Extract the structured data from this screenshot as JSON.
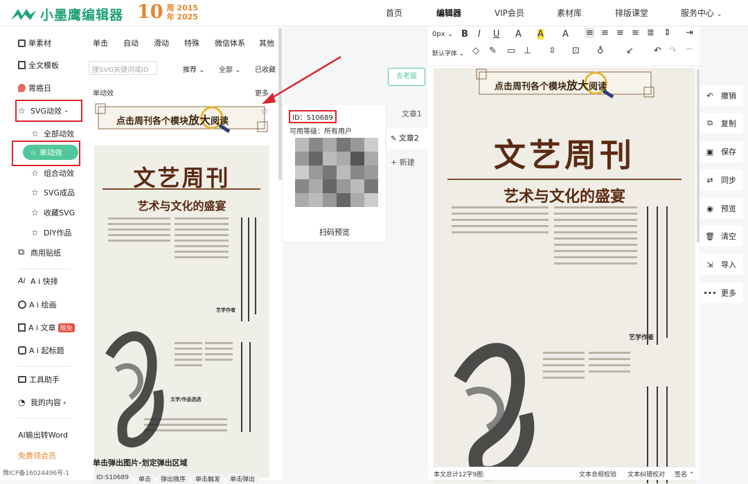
{
  "brand": {
    "name": "小墨鹰编辑器",
    "anniv_ten": "10",
    "anniv_zhou": "周",
    "anniv_years_top": "2015",
    "anniv_nian": "年",
    "anniv_years_bottom": "2025"
  },
  "nav": {
    "home": "首页",
    "editor": "编辑器",
    "vip": "VIP会员",
    "materials": "素材库",
    "course": "排版课堂",
    "service": "服务中心"
  },
  "leftnav": {
    "single_material": "单素材",
    "full_template": "全文模板",
    "stomach_day": "胃癌日",
    "svg_effects": "SVG动效",
    "all_effects": "全部动效",
    "single_effect": "单动效",
    "combo_effect": "组合动效",
    "svg_finished": "SVG成品",
    "fav_svg": "收藏SVG",
    "diy": "DIY作品",
    "stickers": "商用贴纸",
    "ai_layout": "A i 快排",
    "ai_draw": "A i 绘画",
    "ai_article": "A i 文章",
    "ai_article_badge": "限免",
    "ai_headline": "A i 起标题",
    "tools": "工具助手",
    "my_content": "我的内容",
    "ai_word": "AI输出转Word",
    "free_vip": "免费领会员",
    "icp": "豫ICP备16024496号-1"
  },
  "panel": {
    "tabs": [
      "单击",
      "自动",
      "滑动",
      "特殊",
      "微信体系",
      "其他"
    ],
    "search_placeholder": "搜SVG关键词或ID",
    "recommend": "推荐",
    "all": "全部",
    "favorited": "已收藏",
    "section_title": "单动效",
    "more": "更多",
    "card_caption": "单击弹出图片-划定弹出区域",
    "chips": [
      "ID:S10689",
      "单击",
      "弹出微序",
      "单击触发",
      "单击弹出"
    ]
  },
  "banner": {
    "text_prefix": "点击周刊各个模块",
    "text_big": "放大",
    "text_suffix": "阅读"
  },
  "newspaper": {
    "masthead": "文艺周刊",
    "subtitle": "艺术与文化的盛宴",
    "section1": "艺学作者",
    "section2": "文学/作品选选"
  },
  "preview": {
    "id": "ID：S10689",
    "level": "可用等级：所有用户",
    "scan": "扫码预览"
  },
  "articles": {
    "old": "去老版",
    "a1": "文章1",
    "a2": "文章2",
    "new": "新建"
  },
  "toolbar": {
    "font_size": "0px",
    "font_family": "默认字体"
  },
  "right_actions": [
    "撤销",
    "复制",
    "保存",
    "同步",
    "预览",
    "清空",
    "导入",
    "更多"
  ],
  "footer": {
    "wordcount": "本文总计12字9图:",
    "check": "文本合规校验",
    "fix": "文本纠错校对",
    "sign": "签名"
  }
}
